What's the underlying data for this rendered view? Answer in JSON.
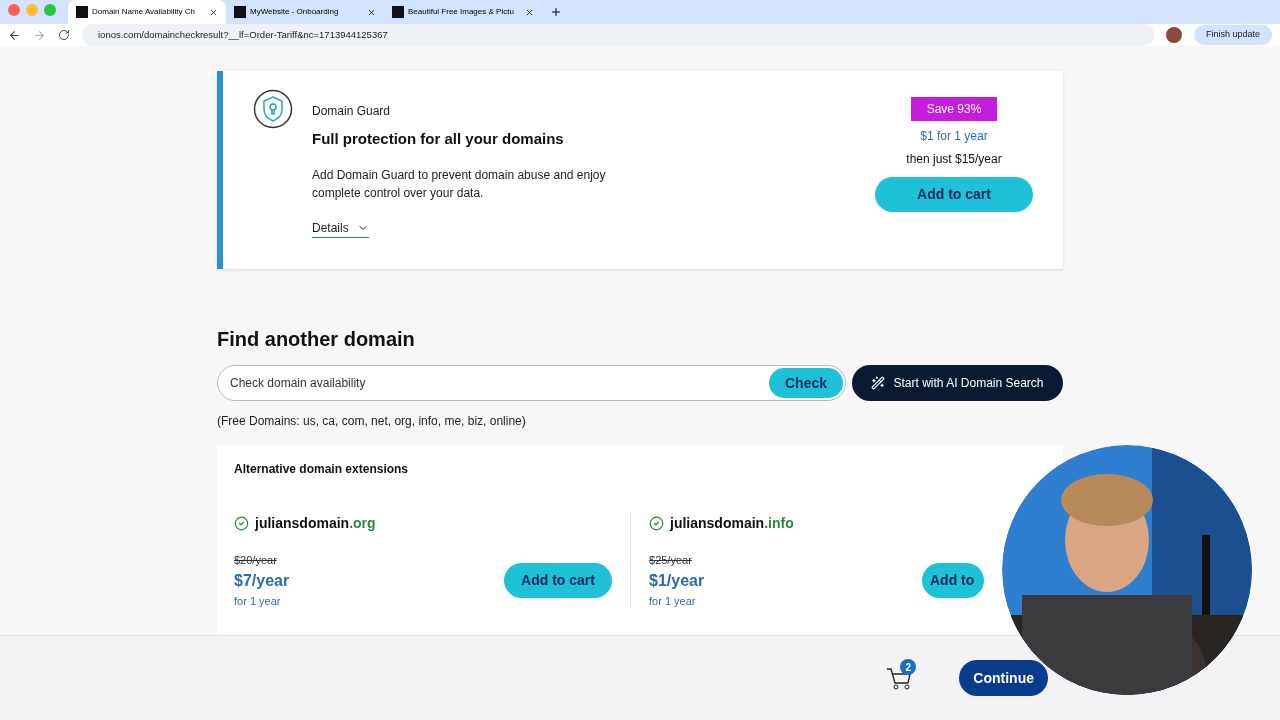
{
  "browser": {
    "tabs": [
      {
        "title": "Domain Name Availability Ch",
        "selected": true
      },
      {
        "title": "MyWebsite - Onboarding",
        "selected": false
      },
      {
        "title": "Beautiful Free Images & Pictu",
        "selected": false
      }
    ],
    "url": "ionos.com/domaincheckresult?__lf=Order-Tariff&nc=1713944125367",
    "update_button": "Finish update"
  },
  "guard": {
    "label": "Domain Guard",
    "title": "Full protection for all your domains",
    "description": "Add Domain Guard to prevent domain abuse and enjoy complete control over your data.",
    "details": "Details",
    "badge": "Save 93%",
    "promo": "$1 for 1 year",
    "then": "then just $15/year",
    "button": "Add to cart"
  },
  "search": {
    "heading": "Find another domain",
    "placeholder": "Check domain availability",
    "check": "Check",
    "ai_button": "Start with AI Domain Search",
    "note": "(Free Domains: us, ca, com, net, org, info, me, biz, online)"
  },
  "alternatives": {
    "heading": "Alternative domain extensions",
    "items": [
      {
        "name": "juliansdomain",
        "tld": ".org",
        "old_price": "$20/year",
        "price": "$7/year",
        "term": "for 1 year",
        "button": "Add to cart"
      },
      {
        "name": "juliansdomain",
        "tld": ".info",
        "old_price": "$25/year",
        "price": "$1/year",
        "term": "for 1 year",
        "button": "Add to"
      }
    ]
  },
  "footer": {
    "cart_count": "2",
    "continue": "Continue"
  }
}
